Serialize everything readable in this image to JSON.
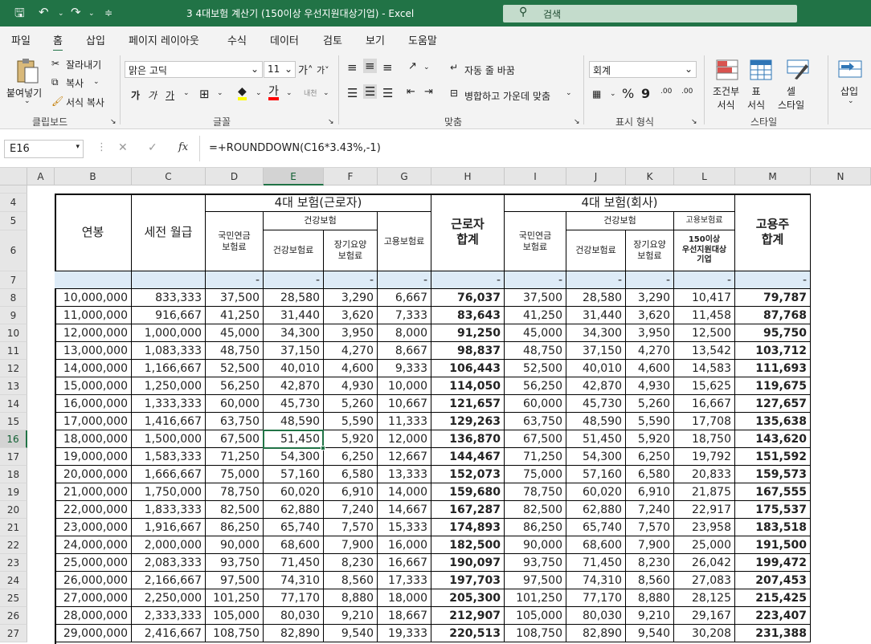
{
  "title_bar": {
    "document_title": "3 4대보험 계산기 (150이상 우선지원대상기업)  -  Excel",
    "search_placeholder": "검색",
    "save_icon": "save-icon",
    "undo_icon": "undo-icon",
    "redo_icon": "redo-icon"
  },
  "menu": [
    "파일",
    "홈",
    "삽입",
    "페이지 레이아웃",
    "수식",
    "데이터",
    "검토",
    "보기",
    "도움말"
  ],
  "ribbon": {
    "clipboard": {
      "paste": "붙여넣기",
      "cut": "잘라내기",
      "copy": "복사",
      "format_painter": "서식 복사",
      "label": "클립보드"
    },
    "font": {
      "name": "맑은 고딕",
      "size": "11",
      "label": "글꼴",
      "bold": "가",
      "italic": "가",
      "underline": "가",
      "font_color_glyph": "가",
      "phonetic": "내천"
    },
    "alignment": {
      "wrap": "자동 줄 바꿈",
      "merge": "병합하고 가운데 맞춤",
      "label": "맞춤"
    },
    "number": {
      "format": "회계",
      "label": "표시 형식"
    },
    "styles": {
      "conditional": "조건부\n서식",
      "table": "표\n서식",
      "cell": "셀\n스타일",
      "label": "스타일"
    },
    "cells": {
      "insert": "삽입"
    }
  },
  "formula_bar": {
    "name_box": "E16",
    "formula": "=+ROUNDDOWN(C16*3.43%,-1)"
  },
  "grid": {
    "columns": [
      "A",
      "B",
      "C",
      "D",
      "E",
      "F",
      "G",
      "H",
      "I",
      "J",
      "K",
      "L",
      "M",
      "N"
    ],
    "selected_column": "E",
    "selected_row": "16",
    "header": {
      "annual": "연봉",
      "monthly": "세전 월급",
      "worker_group": "4대 보험(근로자)",
      "health": "건강보험",
      "pension": "국민연금\n보험료",
      "health_fee": "건강보험료",
      "ltc": "장기요양\n보험료",
      "employment": "고용보험료",
      "worker_total": "근로자\n합계",
      "company_group": "4대 보험(회사)",
      "employment_short": "고용보험료",
      "priority": "150이상\n우선지원대상\n기업",
      "employer_total": "고용주\n합계"
    },
    "row7": [
      "-",
      "-",
      "-",
      "-",
      "-",
      "-",
      "-",
      "-",
      "-",
      "-"
    ],
    "rows": [
      {
        "r": "8",
        "v": [
          "10,000,000",
          "833,333",
          "37,500",
          "28,580",
          "3,290",
          "6,667",
          "76,037",
          "37,500",
          "28,580",
          "3,290",
          "10,417",
          "79,787"
        ]
      },
      {
        "r": "9",
        "v": [
          "11,000,000",
          "916,667",
          "41,250",
          "31,440",
          "3,620",
          "7,333",
          "83,643",
          "41,250",
          "31,440",
          "3,620",
          "11,458",
          "87,768"
        ]
      },
      {
        "r": "10",
        "v": [
          "12,000,000",
          "1,000,000",
          "45,000",
          "34,300",
          "3,950",
          "8,000",
          "91,250",
          "45,000",
          "34,300",
          "3,950",
          "12,500",
          "95,750"
        ]
      },
      {
        "r": "11",
        "v": [
          "13,000,000",
          "1,083,333",
          "48,750",
          "37,150",
          "4,270",
          "8,667",
          "98,837",
          "48,750",
          "37,150",
          "4,270",
          "13,542",
          "103,712"
        ]
      },
      {
        "r": "12",
        "v": [
          "14,000,000",
          "1,166,667",
          "52,500",
          "40,010",
          "4,600",
          "9,333",
          "106,443",
          "52,500",
          "40,010",
          "4,600",
          "14,583",
          "111,693"
        ]
      },
      {
        "r": "13",
        "v": [
          "15,000,000",
          "1,250,000",
          "56,250",
          "42,870",
          "4,930",
          "10,000",
          "114,050",
          "56,250",
          "42,870",
          "4,930",
          "15,625",
          "119,675"
        ]
      },
      {
        "r": "14",
        "v": [
          "16,000,000",
          "1,333,333",
          "60,000",
          "45,730",
          "5,260",
          "10,667",
          "121,657",
          "60,000",
          "45,730",
          "5,260",
          "16,667",
          "127,657"
        ]
      },
      {
        "r": "15",
        "v": [
          "17,000,000",
          "1,416,667",
          "63,750",
          "48,590",
          "5,590",
          "11,333",
          "129,263",
          "63,750",
          "48,590",
          "5,590",
          "17,708",
          "135,638"
        ]
      },
      {
        "r": "16",
        "v": [
          "18,000,000",
          "1,500,000",
          "67,500",
          "51,450",
          "5,920",
          "12,000",
          "136,870",
          "67,500",
          "51,450",
          "5,920",
          "18,750",
          "143,620"
        ]
      },
      {
        "r": "17",
        "v": [
          "19,000,000",
          "1,583,333",
          "71,250",
          "54,300",
          "6,250",
          "12,667",
          "144,467",
          "71,250",
          "54,300",
          "6,250",
          "19,792",
          "151,592"
        ]
      },
      {
        "r": "18",
        "v": [
          "20,000,000",
          "1,666,667",
          "75,000",
          "57,160",
          "6,580",
          "13,333",
          "152,073",
          "75,000",
          "57,160",
          "6,580",
          "20,833",
          "159,573"
        ]
      },
      {
        "r": "19",
        "v": [
          "21,000,000",
          "1,750,000",
          "78,750",
          "60,020",
          "6,910",
          "14,000",
          "159,680",
          "78,750",
          "60,020",
          "6,910",
          "21,875",
          "167,555"
        ]
      },
      {
        "r": "20",
        "v": [
          "22,000,000",
          "1,833,333",
          "82,500",
          "62,880",
          "7,240",
          "14,667",
          "167,287",
          "82,500",
          "62,880",
          "7,240",
          "22,917",
          "175,537"
        ]
      },
      {
        "r": "21",
        "v": [
          "23,000,000",
          "1,916,667",
          "86,250",
          "65,740",
          "7,570",
          "15,333",
          "174,893",
          "86,250",
          "65,740",
          "7,570",
          "23,958",
          "183,518"
        ]
      },
      {
        "r": "22",
        "v": [
          "24,000,000",
          "2,000,000",
          "90,000",
          "68,600",
          "7,900",
          "16,000",
          "182,500",
          "90,000",
          "68,600",
          "7,900",
          "25,000",
          "191,500"
        ]
      },
      {
        "r": "23",
        "v": [
          "25,000,000",
          "2,083,333",
          "93,750",
          "71,450",
          "8,230",
          "16,667",
          "190,097",
          "93,750",
          "71,450",
          "8,230",
          "26,042",
          "199,472"
        ]
      },
      {
        "r": "24",
        "v": [
          "26,000,000",
          "2,166,667",
          "97,500",
          "74,310",
          "8,560",
          "17,333",
          "197,703",
          "97,500",
          "74,310",
          "8,560",
          "27,083",
          "207,453"
        ]
      },
      {
        "r": "25",
        "v": [
          "27,000,000",
          "2,250,000",
          "101,250",
          "77,170",
          "8,880",
          "18,000",
          "205,300",
          "101,250",
          "77,170",
          "8,880",
          "28,125",
          "215,425"
        ]
      },
      {
        "r": "26",
        "v": [
          "28,000,000",
          "2,333,333",
          "105,000",
          "80,030",
          "9,210",
          "18,667",
          "212,907",
          "105,000",
          "80,030",
          "9,210",
          "29,167",
          "223,407"
        ]
      },
      {
        "r": "27",
        "v": [
          "29,000,000",
          "2,416,667",
          "108,750",
          "82,890",
          "9,540",
          "19,333",
          "220,513",
          "108,750",
          "82,890",
          "9,540",
          "30,208",
          "231,388"
        ]
      }
    ]
  },
  "colors": {
    "excel_green": "#217346",
    "row7_fill": "#ddebf7",
    "cell_border": "#000000"
  }
}
